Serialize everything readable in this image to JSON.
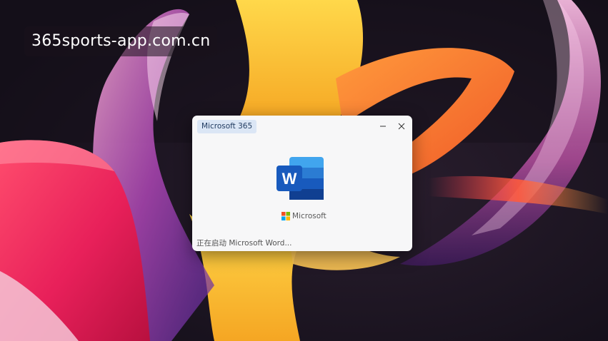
{
  "watermark": {
    "text": "365sports-app.com.cn"
  },
  "splash": {
    "badge_label": "Microsoft 365",
    "brand_label": "Microsoft",
    "status_text": "正在启动 Microsoft Word...",
    "controls": {
      "minimize_icon": "minimize-icon",
      "close_icon": "close-icon"
    },
    "app_icon": "word-icon",
    "app_icon_letter": "W"
  },
  "colors": {
    "word_blue_dark": "#185abd",
    "word_blue_mid": "#2b7cd3",
    "word_blue_light": "#41a5ee",
    "ms_red": "#f25022",
    "ms_green": "#7fba00",
    "ms_blue": "#00a4ef",
    "ms_yellow": "#ffb900"
  }
}
